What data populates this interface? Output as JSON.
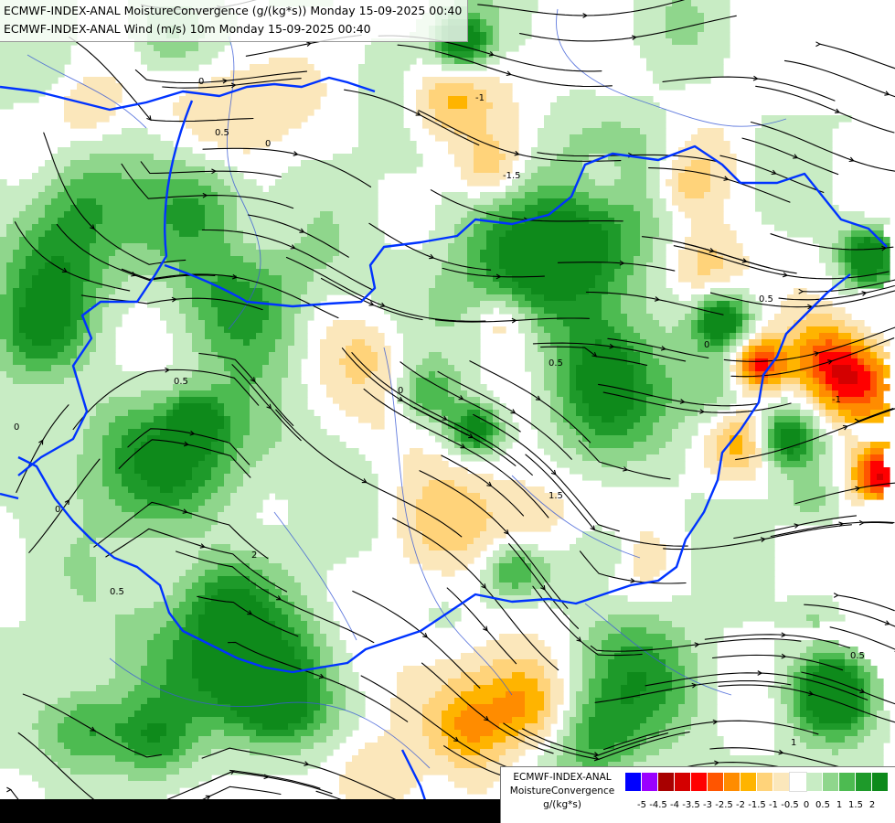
{
  "header": {
    "line1": "ECMWF-INDEX-ANAL MoistureConvergence (g/(kg*s)) Monday 15-09-2025 00:40",
    "line2": "ECMWF-INDEX-ANAL Wind (m/s) 10m Monday 15-09-2025 00:40"
  },
  "legend": {
    "title1": "ECMWF-INDEX-ANAL",
    "title2": "MoistureConvergence",
    "unit": "g/(kg*s)",
    "colors": [
      "#0000ff",
      "#9a00ff",
      "#a80000",
      "#d40000",
      "#ff0000",
      "#ff5500",
      "#ff8c00",
      "#ffb400",
      "#ffd37a",
      "#fbe7bb",
      "#ffffff",
      "#c8ecc4",
      "#8fd68c",
      "#4dbb51",
      "#1e9a2a",
      "#0e8a1b"
    ],
    "ticks": [
      "-5",
      "-4.5",
      "-4",
      "-3.5",
      "-3",
      "-2.5",
      "-2",
      "-1.5",
      "-1",
      "-0.5",
      "0",
      "0.5",
      "1",
      "1.5",
      "2"
    ]
  },
  "map": {
    "contour_labels": [
      "0",
      "0.5",
      "-1",
      "-1.5",
      "1.5",
      "2",
      "0",
      "0.5",
      "0",
      "0.5",
      "-1",
      "0",
      "0.5",
      "0",
      "0.5",
      "1",
      "0",
      "0.5"
    ],
    "colors": {
      "border": "#0033ff",
      "river": "#3a5ad6",
      "stream": "#000000"
    }
  }
}
